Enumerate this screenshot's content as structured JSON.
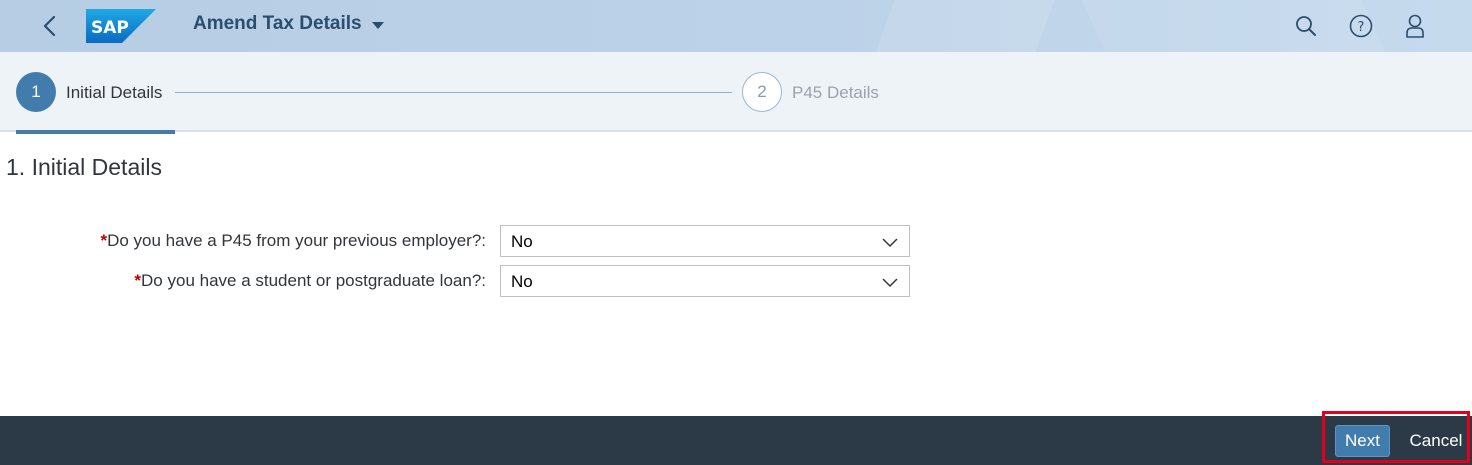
{
  "shell": {
    "logo_text": "SAP",
    "app_title": "Amend Tax Details",
    "icons": [
      "back-icon",
      "search-icon",
      "help-icon",
      "user-icon"
    ]
  },
  "wizard": {
    "steps": [
      {
        "number": "1",
        "label": "Initial Details",
        "state": "current"
      },
      {
        "number": "2",
        "label": "P45 Details",
        "state": "upcoming"
      }
    ]
  },
  "content": {
    "section_title": "1. Initial Details",
    "fields": [
      {
        "required_marker": "*",
        "label": "Do you have a P45 from your previous employer?:",
        "value": "No"
      },
      {
        "required_marker": "*",
        "label": "Do you have a student or postgraduate loan?:",
        "value": "No"
      }
    ]
  },
  "footer": {
    "next_label": "Next",
    "cancel_label": "Cancel"
  },
  "colors": {
    "accent": "#427cac",
    "footer_bg": "#2c3a47",
    "highlight": "#e3001b",
    "required": "#bb0000"
  }
}
